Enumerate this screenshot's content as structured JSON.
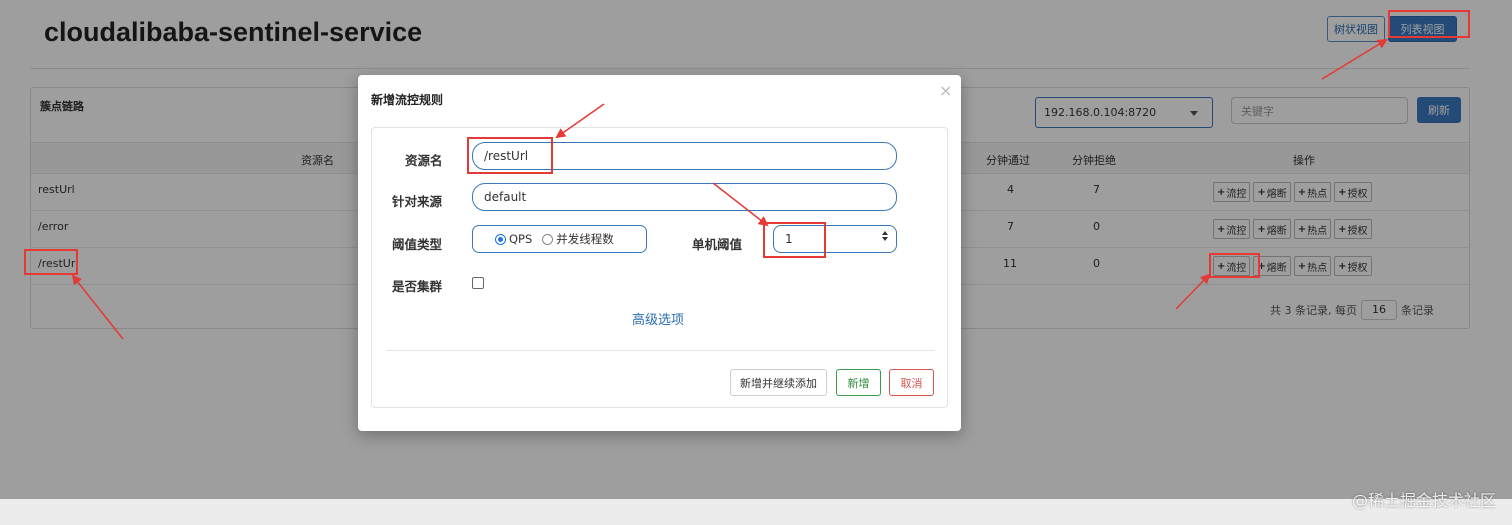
{
  "header": {
    "title": "cloudalibaba-sentinel-service",
    "view_tree_label": "树状视图",
    "view_list_label": "列表视图"
  },
  "panel": {
    "title": "簇点链路",
    "machine_select_value": "192.168.0.104:8720",
    "search_placeholder": "关键字",
    "refresh_label": "刷新",
    "columns": {
      "resource": "资源名",
      "pass_per_min": "分钟通过",
      "block_per_min": "分钟拒绝",
      "ops": "操作"
    },
    "rows": [
      {
        "resource": "restUrl",
        "pass": "4",
        "block": "7"
      },
      {
        "resource": "/error",
        "pass": "7",
        "block": "0"
      },
      {
        "resource": "/restUrl",
        "pass": "11",
        "block": "0"
      }
    ],
    "op_labels": {
      "flow": "流控",
      "degrade": "熔断",
      "hot": "热点",
      "auth": "授权"
    },
    "pager": {
      "prefix": "共 3 条记录, 每页",
      "page_size": "16",
      "suffix": "条记录"
    }
  },
  "modal": {
    "title": "新增流控规则",
    "close_symbol": "×",
    "resource_label": "资源名",
    "resource_value": "/restUrl",
    "origin_label": "针对来源",
    "origin_value": "default",
    "threshold_type_label": "阈值类型",
    "threshold_options": [
      "QPS",
      "并发线程数"
    ],
    "threshold_selected": "QPS",
    "single_threshold_label": "单机阈值",
    "single_threshold_value": "1",
    "cluster_label": "是否集群",
    "cluster_checked": false,
    "advanced_link": "高级选项",
    "btn_add_continue": "新增并继续添加",
    "btn_add": "新增",
    "btn_cancel": "取消"
  },
  "watermark": "@稀土掘金技术社区",
  "colors": {
    "primary": "#3b78c1",
    "success": "#3c9a4a",
    "danger": "#d9534f",
    "annotation": "#e53935"
  }
}
